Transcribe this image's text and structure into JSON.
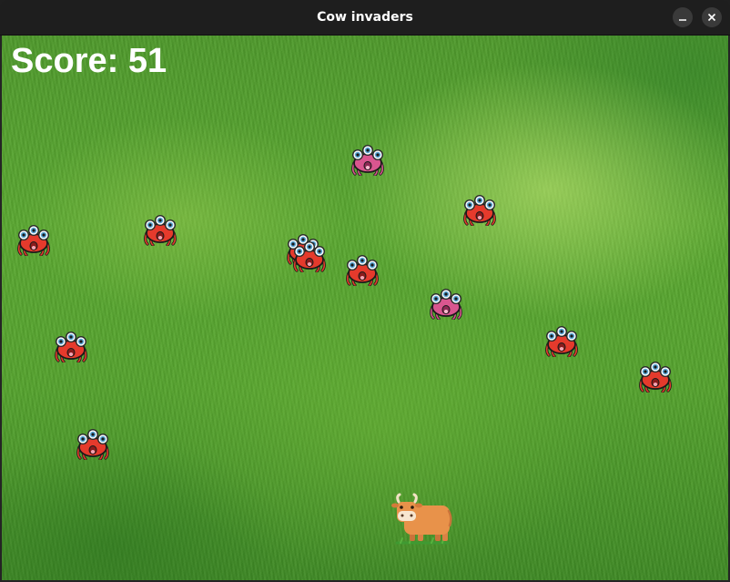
{
  "window": {
    "title": "Cow invaders",
    "minimize_icon": "minimize-icon",
    "close_icon": "close-icon"
  },
  "hud": {
    "score_text": "Score: 51",
    "score": 51
  },
  "sprites": {
    "alien_red": "red-three-eyed-alien-icon",
    "alien_pink": "pink-three-eyed-alien-icon",
    "player": "cow-icon"
  },
  "colors": {
    "alien_red": "#e53a2c",
    "alien_pink": "#d9568f",
    "cow": "#e8924a",
    "grass_dark": "#3f8a25",
    "grass_light": "#8cc84a"
  }
}
